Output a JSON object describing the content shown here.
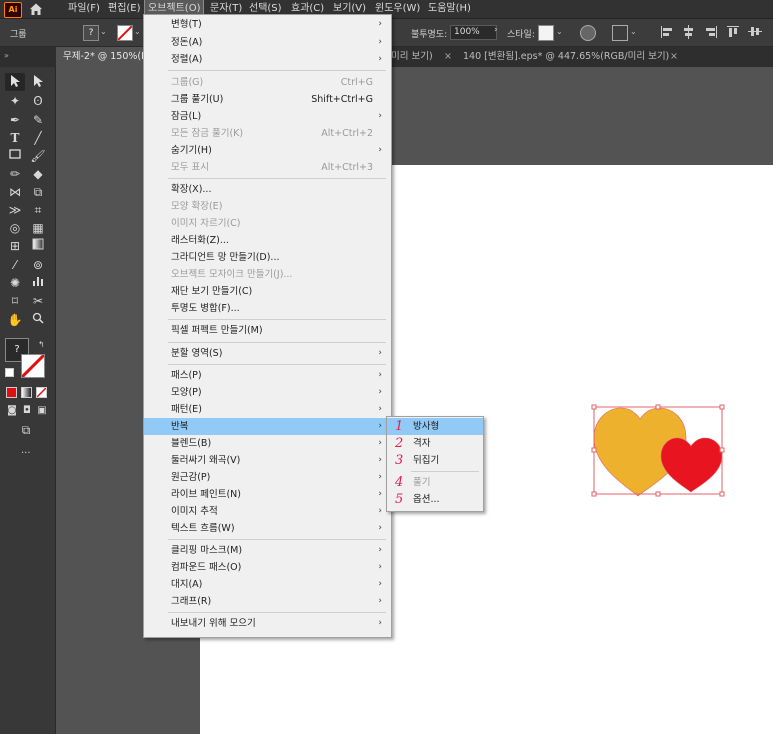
{
  "menubar": {
    "app_logo": "Ai",
    "items": [
      "파일(F)",
      "편집(E)",
      "오브젝트(O)",
      "문자(T)",
      "선택(S)",
      "효과(C)",
      "보기(V)",
      "윈도우(W)",
      "도움말(H)"
    ]
  },
  "controlbar": {
    "group_label": "그룹",
    "opacity_label": "불투명도:",
    "opacity_value": "100%",
    "style_label": "스타일:"
  },
  "tabs": [
    {
      "label": "무제-2* @ 150%(RGB/미리 보기)"
    },
    {
      "label": "미리 보기)"
    },
    {
      "label": "140 [변환됨].eps* @ 447.65%(RGB/미리 보기)"
    }
  ],
  "toolbar": {
    "fill_stroke_text": "?",
    "more_label": "..."
  },
  "object_menu": {
    "items": [
      {
        "label": "변형(T)",
        "shortcut": "",
        "submenu": true,
        "disabled": false
      },
      {
        "label": "정돈(A)",
        "shortcut": "",
        "submenu": true,
        "disabled": false
      },
      {
        "label": "정렬(A)",
        "shortcut": "",
        "submenu": true,
        "disabled": false
      },
      {
        "label": "그룹(G)",
        "shortcut": "Ctrl+G",
        "submenu": false,
        "disabled": true
      },
      {
        "label": "그룹 풀기(U)",
        "shortcut": "Shift+Ctrl+G",
        "submenu": false,
        "disabled": false
      },
      {
        "label": "잠금(L)",
        "shortcut": "",
        "submenu": true,
        "disabled": false
      },
      {
        "label": "모든 잠금 풀기(K)",
        "shortcut": "Alt+Ctrl+2",
        "submenu": false,
        "disabled": true
      },
      {
        "label": "숨기기(H)",
        "shortcut": "",
        "submenu": true,
        "disabled": false
      },
      {
        "label": "모두 표시",
        "shortcut": "Alt+Ctrl+3",
        "submenu": false,
        "disabled": true
      },
      {
        "label": "확장(X)...",
        "shortcut": "",
        "submenu": false,
        "disabled": false
      },
      {
        "label": "모양 확장(E)",
        "shortcut": "",
        "submenu": false,
        "disabled": true
      },
      {
        "label": "이미지 자르기(C)",
        "shortcut": "",
        "submenu": false,
        "disabled": true
      },
      {
        "label": "래스터화(Z)...",
        "shortcut": "",
        "submenu": false,
        "disabled": false
      },
      {
        "label": "그라디언트 망 만들기(D)...",
        "shortcut": "",
        "submenu": false,
        "disabled": false
      },
      {
        "label": "오브젝트 모자이크 만들기(J)...",
        "shortcut": "",
        "submenu": false,
        "disabled": true
      },
      {
        "label": "재단 보기 만들기(C)",
        "shortcut": "",
        "submenu": false,
        "disabled": false
      },
      {
        "label": "투명도 병합(F)...",
        "shortcut": "",
        "submenu": false,
        "disabled": false
      },
      {
        "label": "픽셀 퍼펙트 만들기(M)",
        "shortcut": "",
        "submenu": false,
        "disabled": false
      },
      {
        "label": "분할 영역(S)",
        "shortcut": "",
        "submenu": true,
        "disabled": false
      },
      {
        "label": "패스(P)",
        "shortcut": "",
        "submenu": true,
        "disabled": false
      },
      {
        "label": "모양(P)",
        "shortcut": "",
        "submenu": true,
        "disabled": false
      },
      {
        "label": "패턴(E)",
        "shortcut": "",
        "submenu": true,
        "disabled": false
      },
      {
        "label": "반복",
        "shortcut": "",
        "submenu": true,
        "disabled": false,
        "highlighted": true
      },
      {
        "label": "블렌드(B)",
        "shortcut": "",
        "submenu": true,
        "disabled": false
      },
      {
        "label": "둘러싸기 왜곡(V)",
        "shortcut": "",
        "submenu": true,
        "disabled": false
      },
      {
        "label": "원근감(P)",
        "shortcut": "",
        "submenu": true,
        "disabled": false
      },
      {
        "label": "라이브 페인트(N)",
        "shortcut": "",
        "submenu": true,
        "disabled": false
      },
      {
        "label": "이미지 추적",
        "shortcut": "",
        "submenu": true,
        "disabled": false
      },
      {
        "label": "텍스트 흐름(W)",
        "shortcut": "",
        "submenu": true,
        "disabled": false
      },
      {
        "label": "클리핑 마스크(M)",
        "shortcut": "",
        "submenu": true,
        "disabled": false
      },
      {
        "label": "컴파운드 패스(O)",
        "shortcut": "",
        "submenu": true,
        "disabled": false
      },
      {
        "label": "대지(A)",
        "shortcut": "",
        "submenu": true,
        "disabled": false
      },
      {
        "label": "그래프(R)",
        "shortcut": "",
        "submenu": true,
        "disabled": false
      },
      {
        "label": "내보내기 위해 모으기",
        "shortcut": "",
        "submenu": true,
        "disabled": false
      }
    ]
  },
  "repeat_submenu": {
    "items": [
      {
        "num": "1",
        "label": "방사형",
        "disabled": false,
        "highlighted": true
      },
      {
        "num": "2",
        "label": "격자",
        "disabled": false
      },
      {
        "num": "3",
        "label": "뒤집기",
        "disabled": false
      },
      {
        "num": "4",
        "label": "풀기",
        "disabled": true
      },
      {
        "num": "5",
        "label": "옵션...",
        "disabled": false
      }
    ]
  },
  "colors": {
    "accent_highlight": "#91c9f7",
    "heart_orange": "#eeb12e",
    "heart_red": "#e8141f",
    "selection": "#e0606a",
    "annotation_numbers": "#e0204a"
  }
}
